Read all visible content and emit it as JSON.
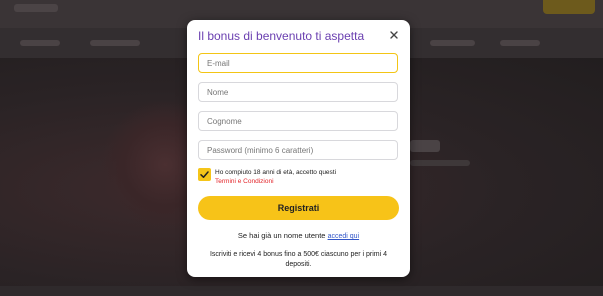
{
  "modal": {
    "title": "Il bonus di benvenuto ti aspetta",
    "close_icon": "close-icon"
  },
  "form": {
    "email_placeholder": "E-mail",
    "name_placeholder": "Nome",
    "surname_placeholder": "Cognome",
    "password_placeholder": "Password (minimo 6 caratteri)",
    "terms_text": "Ho compiuto 18 anni di età, accetto questi",
    "terms_link": "Termini e Condizioni",
    "terms_checked": true,
    "register_label": "Registrati"
  },
  "footer": {
    "login_text": "Se hai già un nome utente",
    "login_link": "accedi qui",
    "promo_text": "Iscriviti e ricevi 4 bonus fino a 500€ ciascuno per i primi 4 depositi."
  },
  "colors": {
    "accent": "#f7c318",
    "title": "#6a3fb0",
    "link_red": "#e3262b",
    "link_blue": "#3256c8"
  }
}
